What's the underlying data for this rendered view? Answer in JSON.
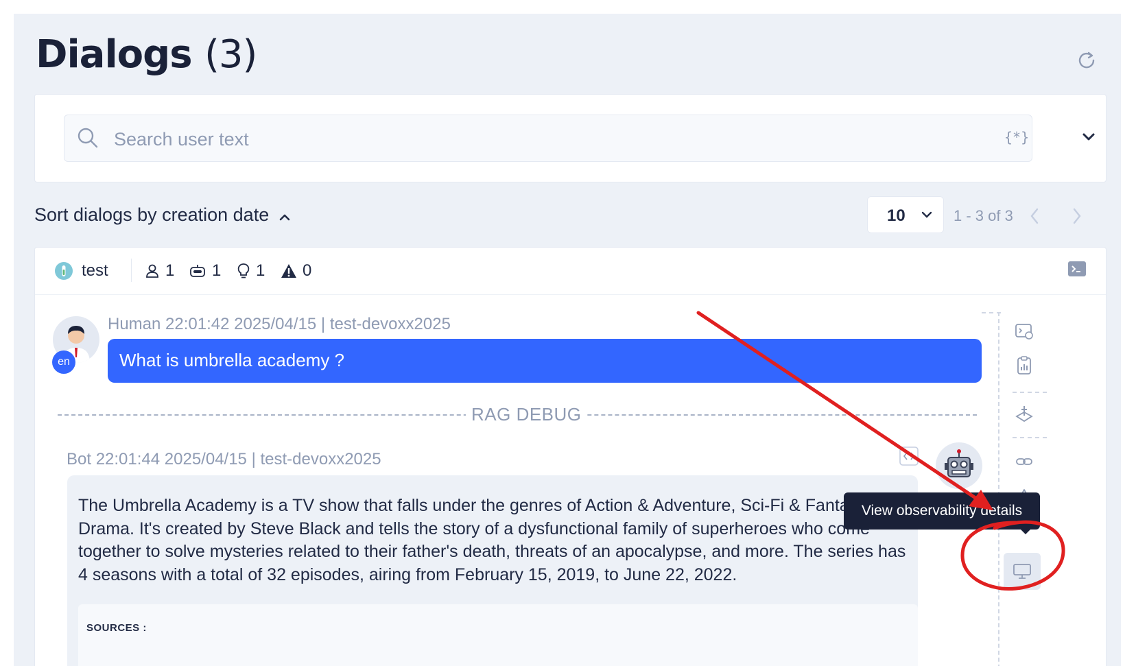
{
  "page": {
    "title": "Dialogs",
    "count": "(3)",
    "refresh_icon": "refresh-icon"
  },
  "search": {
    "placeholder": "Search user text",
    "regex_label": "{*}",
    "icons": [
      "search-icon",
      "regex-icon",
      "chevron-down-icon"
    ]
  },
  "sort": {
    "label": "Sort dialogs by creation date",
    "icon": "chevron-up-icon"
  },
  "pagination": {
    "page_size": "10",
    "range": "1 - 3 of 3"
  },
  "dialog": {
    "connector": "test",
    "stats": [
      {
        "icon": "user-icon",
        "value": "1"
      },
      {
        "icon": "robot-icon",
        "value": "1"
      },
      {
        "icon": "lightbulb-icon",
        "value": "1"
      },
      {
        "icon": "warning-icon",
        "value": "0"
      }
    ],
    "human": {
      "meta": "Human 22:01:42 2025/04/15 | test-devoxx2025",
      "lang": "en",
      "text": "What is umbrella academy ?"
    },
    "rag_label": "RAG DEBUG",
    "bot": {
      "meta": "Bot 22:01:44 2025/04/15 | test-devoxx2025",
      "text": "The Umbrella Academy is a TV show that falls under the genres of Action & Adventure, Sci-Fi & Fantasy, and Drama. It's created by Steve Black and tells the story of a dysfunctional family of superheroes who come together to solve mysteries related to their father's death, threats of an apocalypse, and more. The series has 4 seasons with a total of 32 episodes, airing from February 15, 2019, to June 22, 2022.",
      "sources_label": "SOURCES :"
    },
    "tooltip": "View observability details"
  },
  "colors": {
    "accent": "#3366ff",
    "background": "#edf1f7",
    "annotation": "#e02020"
  }
}
